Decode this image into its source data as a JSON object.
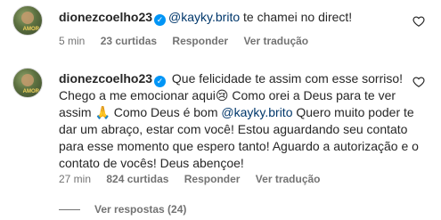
{
  "comments": [
    {
      "username": "dionezcoelho23",
      "mention": "@kayky.brito",
      "text": " te chamei no direct!",
      "time": "5 min",
      "likes": "23 curtidas",
      "reply": "Responder",
      "translate": "Ver tradução"
    },
    {
      "username": "dionezcoelho23",
      "text_part1": " Que felicidade te assim com esse sorriso! Chego a me emocionar aqui",
      "emoji1": "😢",
      "text_part2": " Como orei a Deus para te ver assim ",
      "emoji2": "🙏",
      "text_part3": "  Como Deus é bom ",
      "mention": "@kayky.brito",
      "text_part4": " Quero muito poder te dar um abraço, estar com você! Estou aguardando seu contato para esse momento que espero tanto! Aguardo a autorização e o contato de vocês! Deus abençoe!",
      "time": "27 min",
      "likes": "824 curtidas",
      "reply": "Responder",
      "translate": "Ver tradução"
    }
  ],
  "view_replies": "Ver respostas (24)",
  "avatar_tag": "AMOR",
  "verified_glyph": "✓",
  "colors": {
    "link": "#00376b",
    "verified": "#0095f6",
    "meta": "#737373"
  },
  "icons": [
    "verified-badge-icon",
    "heart-icon"
  ]
}
